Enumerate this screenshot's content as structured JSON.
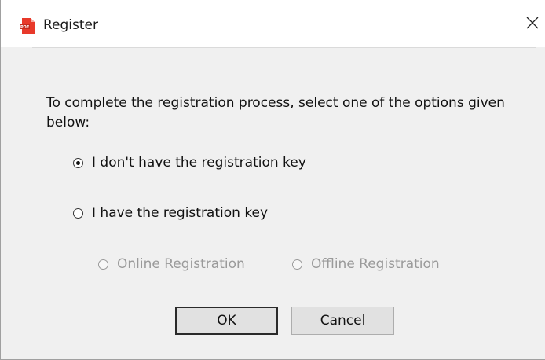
{
  "window": {
    "title": "Register",
    "app_icon": "pdf-app-icon",
    "close_icon": "close-icon"
  },
  "instructions": "To complete the registration process, select one of the options given below:",
  "options": {
    "no_key": {
      "label": "I don't have the registration key",
      "checked": true,
      "enabled": true
    },
    "have_key": {
      "label": "I  have the registration key",
      "checked": false,
      "enabled": true
    },
    "online": {
      "label": "Online Registration",
      "checked": false,
      "enabled": false
    },
    "offline": {
      "label": "Offline Registration",
      "checked": false,
      "enabled": false
    }
  },
  "buttons": {
    "ok": "OK",
    "cancel": "Cancel"
  },
  "colors": {
    "icon_red": "#e8392a",
    "disabled_text": "#9a9a9a"
  }
}
